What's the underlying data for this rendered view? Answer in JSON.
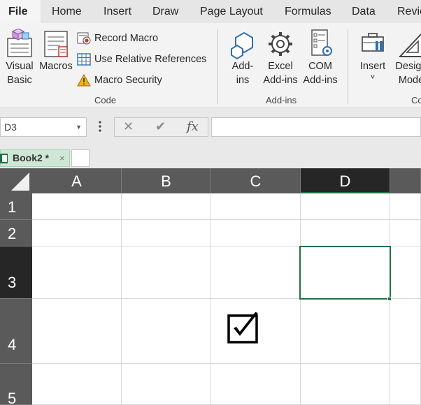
{
  "menu": {
    "tabs": [
      "File",
      "Home",
      "Insert",
      "Draw",
      "Page Layout",
      "Formulas",
      "Data",
      "Revie"
    ]
  },
  "ribbon": {
    "code_group": {
      "visual_basic": [
        "Visual",
        "Basic"
      ],
      "macros": "Macros",
      "record_macro": "Record Macro",
      "use_relative_references": "Use Relative References",
      "macro_security": "Macro Security",
      "label": "Code"
    },
    "addins_group": {
      "addins": [
        "Add-",
        "ins"
      ],
      "excel_addins": [
        "Excel",
        "Add-ins"
      ],
      "com_addins": [
        "COM",
        "Add-ins"
      ],
      "label": "Add-ins"
    },
    "controls_group": {
      "insert": "Insert",
      "insert_arrow": "˅",
      "design_mode": [
        "Design",
        "Mode"
      ],
      "label": "Co"
    }
  },
  "formula_bar": {
    "name_box": "D3",
    "cancel_symbol": "✕",
    "enter_symbol": "✔",
    "fx_label": "fx",
    "formula_value": ""
  },
  "workbook": {
    "tab_label": "Book2 *",
    "close_symbol": "×"
  },
  "sheet": {
    "columns": [
      "A",
      "B",
      "C",
      "D"
    ],
    "rows": [
      "1",
      "2",
      "3",
      "4",
      "5"
    ],
    "selected_cell": "D3",
    "accent": "#1e7145"
  }
}
